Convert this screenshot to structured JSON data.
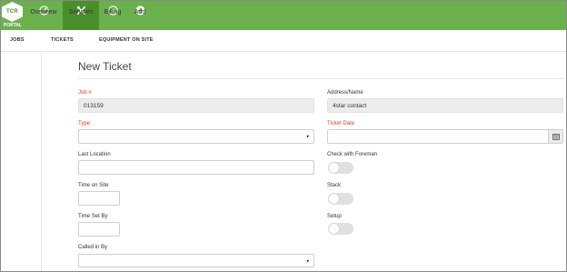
{
  "brand": {
    "logo_text": "TCR",
    "portal_text": "PORTAL"
  },
  "topnav": {
    "items": [
      {
        "label": "Overview",
        "icon": "speedometer-icon",
        "active": false
      },
      {
        "label": "Services",
        "icon": "tools-icon",
        "active": true
      },
      {
        "label": "Billing",
        "icon": "dollar-icon",
        "active": false
      },
      {
        "label": "Add",
        "icon": "plus-icon",
        "active": false
      }
    ]
  },
  "subnav": {
    "items": [
      "JOBS",
      "TICKETS",
      "EQUIPMENT ON SITE"
    ]
  },
  "page": {
    "title": "New Ticket"
  },
  "form": {
    "job_no": {
      "label": "Job #",
      "value": "013159",
      "required": true
    },
    "address_name": {
      "label": "Address/Name",
      "value": "4star contact"
    },
    "type": {
      "label": "Type",
      "value": "",
      "required": true
    },
    "ticket_date": {
      "label": "Ticket Date",
      "value": "",
      "required": true
    },
    "last_location": {
      "label": "Last Location",
      "value": ""
    },
    "check_with_foreman": {
      "label": "Check with Foreman",
      "value": false
    },
    "time_on_site": {
      "label": "Time on Site",
      "value": ""
    },
    "stack": {
      "label": "Stack",
      "value": false
    },
    "time_set_by": {
      "label": "Time Set By",
      "value": ""
    },
    "setup": {
      "label": "Setup",
      "value": false
    },
    "called_in_by": {
      "label": "Called in By",
      "value": ""
    }
  },
  "colors": {
    "brand_green": "#6ab04c",
    "active_green": "#4a8f2c",
    "required_red": "#e23b2a"
  }
}
